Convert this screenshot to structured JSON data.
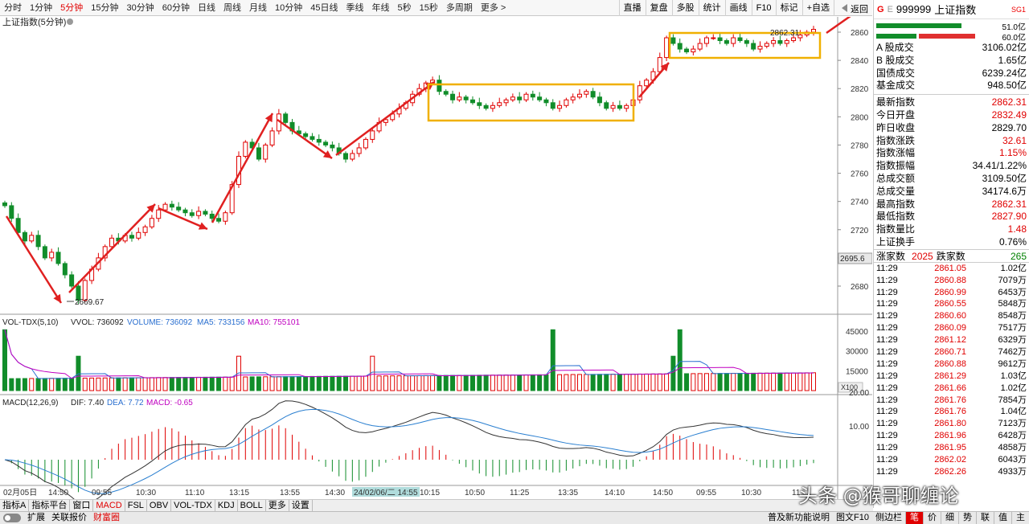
{
  "topbar": {
    "timeframes": [
      "分时",
      "1分钟",
      "5分钟",
      "15分钟",
      "30分钟",
      "60分钟",
      "日线",
      "周线",
      "月线",
      "10分钟",
      "45日线",
      "季线",
      "年线",
      "5秒",
      "15秒",
      "多周期",
      "更多 >"
    ],
    "active_timeframe": "5分钟",
    "tools": [
      "直播",
      "复盘",
      "多股",
      "统计",
      "画线",
      "F10",
      "标记",
      "+自选"
    ],
    "back_label": "返回"
  },
  "chart": {
    "title": "上证指数(5分钟)",
    "min_label": "2669.67",
    "max_label": "2862.31",
    "current_price_label": "2695.6",
    "y_ticks": [
      "2860",
      "2840",
      "2820",
      "2800",
      "2780",
      "2760",
      "2740",
      "2720",
      "2700",
      "2680"
    ],
    "vol_header": {
      "name": "VOL-TDX(5,10)",
      "vvol": "VVOL: 736092",
      "volume": "VOLUME: 736092",
      "ma5": "MA5: 733156",
      "ma10": "MA10: 755101"
    },
    "vol_ticks": [
      "45000",
      "30000",
      "15000"
    ],
    "vol_unit": "X100",
    "macd_header": {
      "name": "MACD(12,26,9)",
      "dif": "DIF: 7.40",
      "dea": "DEA: 7.72",
      "macd": "MACD: -0.65"
    },
    "macd_ticks": [
      "20.00",
      "10.00"
    ],
    "time_labels": [
      "02月05日",
      "14:50",
      "09:55",
      "10:30",
      "11:10",
      "13:15",
      "13:55",
      "14:30",
      "24/02/06/二 14:55",
      "10:15",
      "10:50",
      "11:25",
      "13:35",
      "14:10",
      "14:50",
      "09:55",
      "10:30",
      "11"
    ],
    "colors": {
      "up": "#e00000",
      "down": "#118d2a",
      "box": "#f0b000",
      "ma5": "#2a6fd0",
      "ma10": "#c000c0",
      "dif": "#333333",
      "dea": "#2a7fd0"
    }
  },
  "panel": {
    "badge_g": "G",
    "badge_e": "E",
    "code": "999999",
    "name": "上证指数",
    "sg": "SG1",
    "bar1_pct": "51.0亿",
    "bar2_pct": "60.0亿",
    "stats": [
      {
        "k": "A 股成交",
        "v": "3106.02亿",
        "red": false
      },
      {
        "k": "B 股成交",
        "v": "1.65亿",
        "red": false
      },
      {
        "k": "国债成交",
        "v": "6239.24亿",
        "red": false
      },
      {
        "k": "基金成交",
        "v": "948.50亿",
        "red": false
      }
    ],
    "quotes": [
      {
        "k": "最新指数",
        "v": "2862.31",
        "red": true
      },
      {
        "k": "今日开盘",
        "v": "2832.49",
        "red": true
      },
      {
        "k": "昨日收盘",
        "v": "2829.70",
        "red": false
      },
      {
        "k": "指数涨跌",
        "v": "32.61",
        "red": true
      },
      {
        "k": "指数涨幅",
        "v": "1.15%",
        "red": true
      },
      {
        "k": "指数振幅",
        "v": "34.41/1.22%",
        "red": false
      },
      {
        "k": "总成交额",
        "v": "3109.50亿",
        "red": false
      },
      {
        "k": "总成交量",
        "v": "34174.6万",
        "red": false
      },
      {
        "k": "最高指数",
        "v": "2862.31",
        "red": true
      },
      {
        "k": "最低指数",
        "v": "2827.90",
        "red": true
      },
      {
        "k": "指数量比",
        "v": "1.48",
        "red": true
      },
      {
        "k": "上证换手",
        "v": "0.76%",
        "red": false
      }
    ],
    "adv_label": "涨家数",
    "adv_value": "2025",
    "dec_label": "跌家数",
    "dec_value": "265",
    "ticks": [
      {
        "t": "11:29",
        "p": "2861.05",
        "v": "1.02亿"
      },
      {
        "t": "11:29",
        "p": "2860.88",
        "v": "7079万"
      },
      {
        "t": "11:29",
        "p": "2860.99",
        "v": "6453万"
      },
      {
        "t": "11:29",
        "p": "2860.55",
        "v": "5848万"
      },
      {
        "t": "11:29",
        "p": "2860.60",
        "v": "8548万"
      },
      {
        "t": "11:29",
        "p": "2860.09",
        "v": "7517万"
      },
      {
        "t": "11:29",
        "p": "2861.12",
        "v": "6329万"
      },
      {
        "t": "11:29",
        "p": "2860.71",
        "v": "7462万"
      },
      {
        "t": "11:29",
        "p": "2860.88",
        "v": "9612万"
      },
      {
        "t": "11:29",
        "p": "2861.29",
        "v": "1.03亿"
      },
      {
        "t": "11:29",
        "p": "2861.66",
        "v": "1.02亿"
      },
      {
        "t": "11:29",
        "p": "2861.76",
        "v": "7854万"
      },
      {
        "t": "11:29",
        "p": "2861.76",
        "v": "1.04亿"
      },
      {
        "t": "11:29",
        "p": "2861.80",
        "v": "7123万"
      },
      {
        "t": "11:29",
        "p": "2861.96",
        "v": "6428万"
      },
      {
        "t": "11:29",
        "p": "2861.95",
        "v": "4858万"
      },
      {
        "t": "11:29",
        "p": "2862.02",
        "v": "6043万"
      },
      {
        "t": "11:29",
        "p": "2862.26",
        "v": "4933万"
      }
    ]
  },
  "bottom": {
    "tabs": [
      "指标A",
      "指标平台",
      "窗口",
      "MACD",
      "FSL",
      "OBV",
      "VOL-TDX",
      "KDJ",
      "BOLL",
      "更多",
      "设置"
    ],
    "active_tab": "MACD"
  },
  "status": {
    "items": [
      "扩展",
      "关联报价",
      "财富圈"
    ],
    "news": "普及新功能说明",
    "f10": "图文F10",
    "sidebar": "侧边栏",
    "right_tabs": [
      "笔",
      "价",
      "细",
      "势",
      "联",
      "值",
      "主"
    ]
  },
  "watermark": "头条 @猴哥聊缠论"
}
